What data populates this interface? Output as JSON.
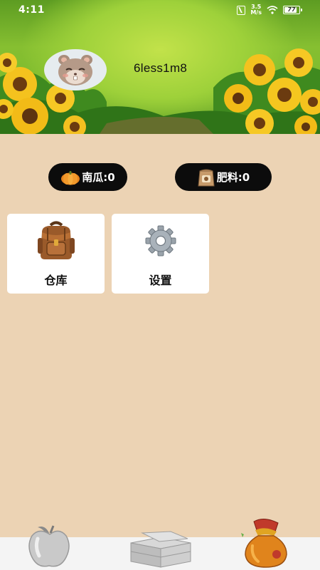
{
  "status_bar": {
    "time": "4:11",
    "speed_value": "3.5",
    "speed_unit": "M/s",
    "battery": "77",
    "icons": [
      "nfc-icon",
      "wifi-icon",
      "battery-icon"
    ]
  },
  "profile": {
    "username": "6less1m8",
    "avatar": "hamster-avatar"
  },
  "resources": {
    "pumpkin_label": "南瓜:0",
    "fertilizer_label": "肥料:0"
  },
  "menu": {
    "warehouse_label": "仓库",
    "settings_label": "设置"
  },
  "bottom_nav": {
    "items": [
      "apple-icon",
      "crate-icon",
      "lucky-bag-icon"
    ],
    "active": "lucky-bag-icon"
  },
  "colors": {
    "page_background": "#ecd3b4",
    "pill_background": "#0c0c0c",
    "card_background": "#ffffff",
    "nav_background": "#f4f4f4"
  }
}
